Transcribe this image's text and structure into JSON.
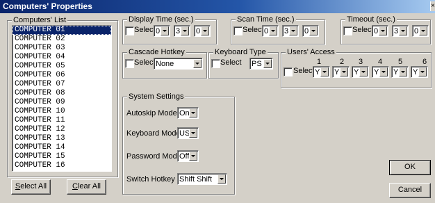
{
  "window": {
    "title": "Computers' Properties",
    "close_glyph": "×"
  },
  "computers_list": {
    "label": "Computers' List",
    "items": [
      "COMPUTER 01",
      "COMPUTER 02",
      "COMPUTER 03",
      "COMPUTER 04",
      "COMPUTER 05",
      "COMPUTER 06",
      "COMPUTER 07",
      "COMPUTER 08",
      "COMPUTER 09",
      "COMPUTER 10",
      "COMPUTER 11",
      "COMPUTER 12",
      "COMPUTER 13",
      "COMPUTER 14",
      "COMPUTER 15",
      "COMPUTER 16"
    ],
    "selected_index": 0,
    "select_all_key": "S",
    "select_all_rest": "elect All",
    "clear_all_key": "C",
    "clear_all_rest": "lear All"
  },
  "display_time": {
    "label": "Display Time (sec.)",
    "select_label": "Select",
    "values": [
      "0",
      "3",
      "0"
    ]
  },
  "scan_time": {
    "label": "Scan Time (sec.)",
    "select_label": "Select",
    "values": [
      "0",
      "3",
      "0"
    ]
  },
  "timeout": {
    "label": "Timeout (sec.)",
    "select_label": "Select",
    "values": [
      "0",
      "3",
      "0"
    ]
  },
  "cascade_hotkey": {
    "label": "Cascade Hotkey",
    "select_label": "Select",
    "value": "None"
  },
  "keyboard_type": {
    "label": "Keyboard Type",
    "select_label": "Select",
    "value": "PS"
  },
  "users_access": {
    "label": "Users' Access",
    "select_label": "Select",
    "columns": [
      "1",
      "2",
      "3",
      "4",
      "5",
      "6"
    ],
    "values": [
      "Y",
      "Y",
      "Y",
      "Y",
      "Y",
      "Y"
    ]
  },
  "system_settings": {
    "label": "System Settings",
    "autoskip_label": "Autoskip Mode",
    "autoskip_value": "On",
    "keyboard_label": "Keyboard Mode",
    "keyboard_value": "US",
    "password_label": "Password Mode",
    "password_value": "Off",
    "hotkey_label": "Switch Hotkey",
    "hotkey_value": "Shift Shift"
  },
  "buttons": {
    "ok": "OK",
    "cancel": "Cancel"
  }
}
